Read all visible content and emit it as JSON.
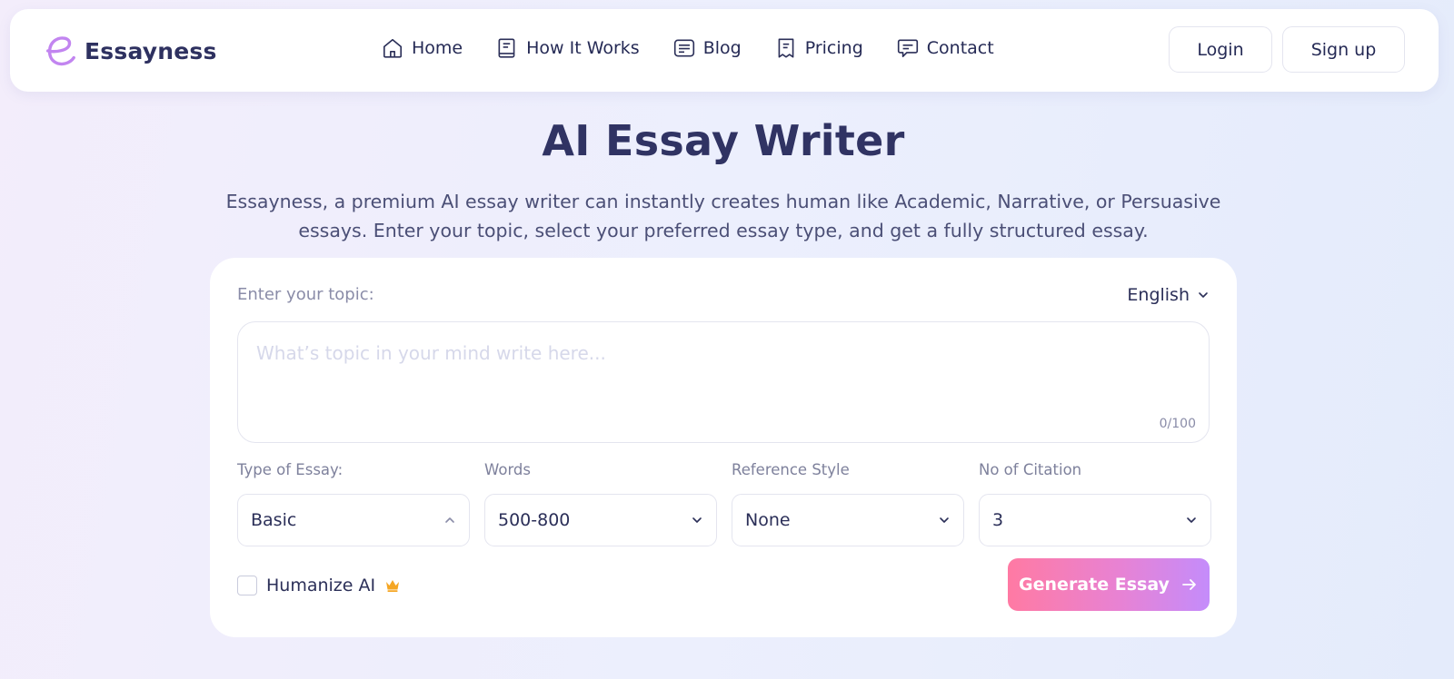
{
  "brand": {
    "name": "Essayness",
    "logo_color": "#c285f0"
  },
  "nav": {
    "items": [
      {
        "label": "Home",
        "icon": "home-icon"
      },
      {
        "label": "How It Works",
        "icon": "book-icon"
      },
      {
        "label": "Blog",
        "icon": "blog-icon"
      },
      {
        "label": "Pricing",
        "icon": "price-tag-icon"
      },
      {
        "label": "Contact",
        "icon": "chat-icon"
      }
    ]
  },
  "auth": {
    "login": "Login",
    "signup": "Sign up"
  },
  "hero": {
    "title": "AI Essay Writer",
    "description": "Essayness, a premium AI essay writer can instantly creates human like Academic, Narrative, or Persuasive essays. Enter your topic, select your preferred essay type, and get a fully structured essay."
  },
  "form": {
    "topic_label": "Enter your topic:",
    "language": "English",
    "topic_placeholder": "What’s topic in your mind write here...",
    "topic_value": "",
    "counter": "0/100",
    "fields": [
      {
        "label": "Type of Essay:",
        "value": "Basic",
        "chevron": "up"
      },
      {
        "label": "Words",
        "value": "500-800",
        "chevron": "down"
      },
      {
        "label": "Reference Style",
        "value": "None",
        "chevron": "down"
      },
      {
        "label": "No of Citation",
        "value": "3",
        "chevron": "down"
      }
    ],
    "humanize_label": "Humanize AI",
    "humanize_checked": false,
    "generate_label": "Generate Essay"
  },
  "colors": {
    "accent_gradient_start": "#ff7aa3",
    "accent_gradient_end": "#c48cfb",
    "crown": "#f5a623",
    "text_dark": "#2c2f5c"
  }
}
